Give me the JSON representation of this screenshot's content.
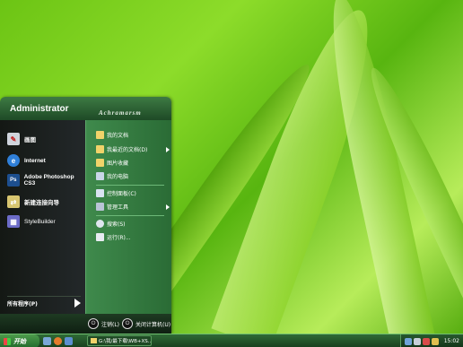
{
  "start_menu": {
    "username": "Administrator",
    "brand": "Achramarsm",
    "pinned": [
      {
        "label": "画图",
        "icon": "paint-icon",
        "color": "#cfd4dc"
      },
      {
        "label": "Internet",
        "icon": "internet-explorer-icon",
        "color": "#2f7fd8"
      },
      {
        "label": "Adobe Photoshop CS3",
        "icon": "photoshop-icon",
        "glyph": "Ps",
        "color": "#1d4f8f"
      },
      {
        "label": "新建连接向导",
        "icon": "connection-wizard-icon",
        "color": "#d8c670"
      },
      {
        "label": "StyleBuilder",
        "icon": "stylebuilder-icon",
        "color": "#6c6cc8"
      }
    ],
    "all_programs": "所有程序(P)",
    "right_items": [
      {
        "label": "我的文档",
        "icon": "my-documents-icon",
        "color": "#f1d36a",
        "submenu": false
      },
      {
        "label": "我最近的文档(D)",
        "icon": "recent-documents-icon",
        "color": "#f1d36a",
        "submenu": true
      },
      {
        "label": "图片收藏",
        "icon": "my-pictures-icon",
        "color": "#f1d36a",
        "submenu": false
      },
      {
        "label": "我的电脑",
        "icon": "my-computer-icon",
        "color": "#c9d6e8",
        "submenu": false
      },
      {
        "label": "控制面板(C)",
        "icon": "control-panel-icon",
        "color": "#d9e3f1",
        "submenu": false
      },
      {
        "label": "管理工具",
        "icon": "admin-tools-icon",
        "color": "#b9c4d6",
        "submenu": true
      },
      {
        "label": "搜索(S)",
        "icon": "search-icon",
        "color": "#dfe6ef",
        "submenu": false
      },
      {
        "label": "运行(R)...",
        "icon": "run-icon",
        "color": "#e8ecf2",
        "submenu": false
      }
    ],
    "logoff": "注销(L)",
    "shutdown": "关闭计算机(U)"
  },
  "taskbar": {
    "start_label": "开始",
    "task_item": "G:\\我/最下载\\WB+XS...",
    "clock": "15:02"
  }
}
